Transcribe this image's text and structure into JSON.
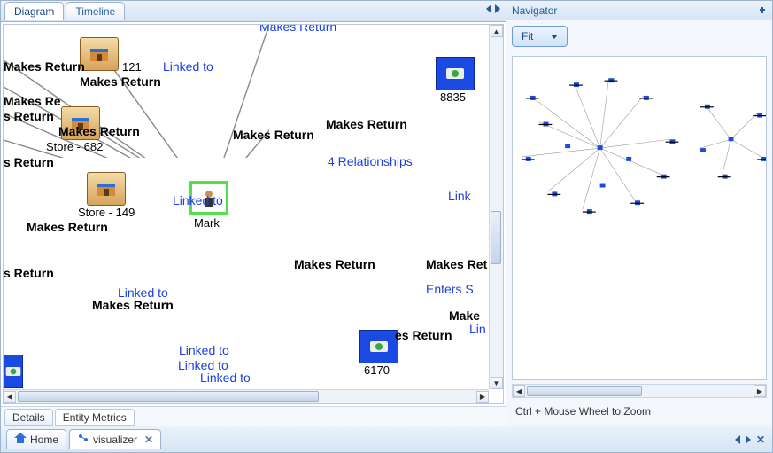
{
  "tabs": {
    "diagram": "Diagram",
    "timeline": "Timeline"
  },
  "navigator": {
    "title": "Navigator",
    "fit": "Fit",
    "hint": "Ctrl + Mouse Wheel to Zoom"
  },
  "bottom_tabs": {
    "details": "Details",
    "entity_metrics": "Entity Metrics"
  },
  "footer": {
    "home": "Home",
    "visualizer": "visualizer"
  },
  "nodes": {
    "store121": "121",
    "store682": "Store - 682",
    "store149": "Store - 149",
    "mark": "Mark",
    "txn8835": "8835",
    "txn6170": "6170"
  },
  "labels": {
    "makes_return": "Makes Return",
    "makes_re": "Makes Re",
    "makes_ret": "Makes Ret",
    "s_return": "s Return",
    "es_return": "es Return",
    "linked_to": "Linked to",
    "relationships": "4 Relationships",
    "enters_s": "Enters S",
    "make": "Make",
    "lin": "Lin",
    "link": "Link"
  }
}
